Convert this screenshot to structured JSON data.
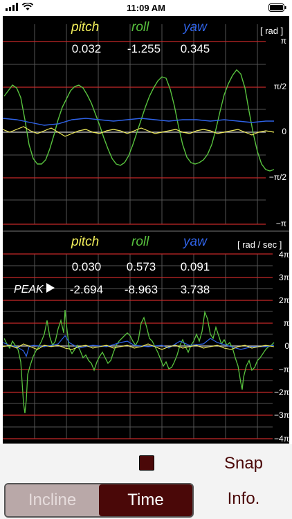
{
  "status_bar": {
    "time": "11:09 AM"
  },
  "colors": {
    "pitch": "#f2ef5a",
    "roll": "#58c23e",
    "yaw": "#2f63e8",
    "accent": "#4a0808"
  },
  "top_panel": {
    "labels": {
      "pitch": "pitch",
      "roll": "roll",
      "yaw": "yaw"
    },
    "unit": "[ rad ]",
    "values": {
      "pitch": "0.032",
      "roll": "-1.255",
      "yaw": "0.345"
    },
    "ticks": [
      "π",
      "π/2",
      "0",
      "−π/2",
      "−π"
    ]
  },
  "bottom_panel": {
    "labels": {
      "pitch": "pitch",
      "roll": "roll",
      "yaw": "yaw"
    },
    "unit": "[ rad / sec ]",
    "values": {
      "pitch": "0.030",
      "roll": "0.573",
      "yaw": "0.091"
    },
    "peak_label": "PEAK",
    "peak": {
      "pitch": "-2.694",
      "roll": "-8.963",
      "yaw": "3.738"
    },
    "ticks": [
      "4π",
      "3π",
      "2π",
      "π",
      "0",
      "−π",
      "−2π",
      "−3π",
      "−4π"
    ]
  },
  "controls": {
    "snap": "Snap",
    "info": "Info.",
    "tabs": [
      {
        "label": "Incline",
        "active": false
      },
      {
        "label": "Time",
        "active": true
      }
    ]
  }
}
